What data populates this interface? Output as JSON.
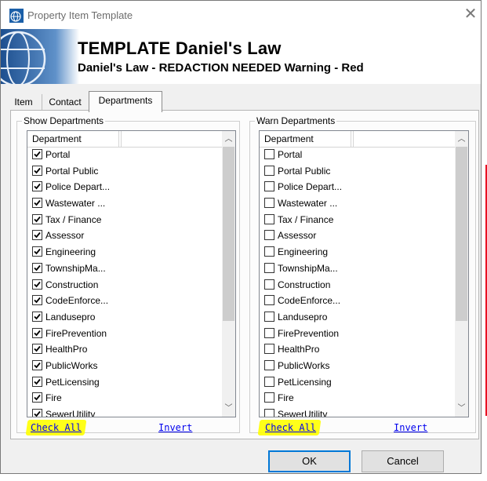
{
  "window": {
    "title": "Property Item Template",
    "close_icon": "close-icon"
  },
  "banner": {
    "title": "TEMPLATE Daniel's Law",
    "subtitle": "Daniel's Law - REDACTION NEEDED Warning - Red"
  },
  "tabs": [
    {
      "label": "Item",
      "active": false
    },
    {
      "label": "Contact",
      "active": false
    },
    {
      "label": "Departments",
      "active": true
    }
  ],
  "show_departments": {
    "group_label": "Show Departments",
    "column_header": "Department",
    "items": [
      {
        "label": "Portal",
        "checked": true
      },
      {
        "label": "Portal Public",
        "checked": true
      },
      {
        "label": "Police Depart...",
        "checked": true
      },
      {
        "label": "Wastewater ...",
        "checked": true
      },
      {
        "label": "Tax / Finance",
        "checked": true
      },
      {
        "label": "Assessor",
        "checked": true
      },
      {
        "label": "Engineering",
        "checked": true
      },
      {
        "label": "TownshipMa...",
        "checked": true
      },
      {
        "label": "Construction",
        "checked": true
      },
      {
        "label": "CodeEnforce...",
        "checked": true
      },
      {
        "label": "Landusepro",
        "checked": true
      },
      {
        "label": "FirePrevention",
        "checked": true
      },
      {
        "label": "HealthPro",
        "checked": true
      },
      {
        "label": "PublicWorks",
        "checked": true
      },
      {
        "label": "PetLicensing",
        "checked": true
      },
      {
        "label": "Fire",
        "checked": true
      },
      {
        "label": "SewerUtility",
        "checked": true
      }
    ],
    "check_all": "Check All",
    "invert": "Invert"
  },
  "warn_departments": {
    "group_label": "Warn Departments",
    "column_header": "Department",
    "items": [
      {
        "label": "Portal",
        "checked": false
      },
      {
        "label": "Portal Public",
        "checked": false
      },
      {
        "label": "Police Depart...",
        "checked": false
      },
      {
        "label": "Wastewater ...",
        "checked": false
      },
      {
        "label": "Tax / Finance",
        "checked": false
      },
      {
        "label": "Assessor",
        "checked": false
      },
      {
        "label": "Engineering",
        "checked": false
      },
      {
        "label": "TownshipMa...",
        "checked": false
      },
      {
        "label": "Construction",
        "checked": false
      },
      {
        "label": "CodeEnforce...",
        "checked": false
      },
      {
        "label": "Landusepro",
        "checked": false
      },
      {
        "label": "FirePrevention",
        "checked": false
      },
      {
        "label": "HealthPro",
        "checked": false
      },
      {
        "label": "PublicWorks",
        "checked": false
      },
      {
        "label": "PetLicensing",
        "checked": false
      },
      {
        "label": "Fire",
        "checked": false
      },
      {
        "label": "SewerUtility",
        "checked": false
      }
    ],
    "check_all": "Check All",
    "invert": "Invert"
  },
  "buttons": {
    "ok": "OK",
    "cancel": "Cancel"
  },
  "colors": {
    "highlight": "#ffff00",
    "link": "#0000ee",
    "accent": "#0078d7"
  }
}
